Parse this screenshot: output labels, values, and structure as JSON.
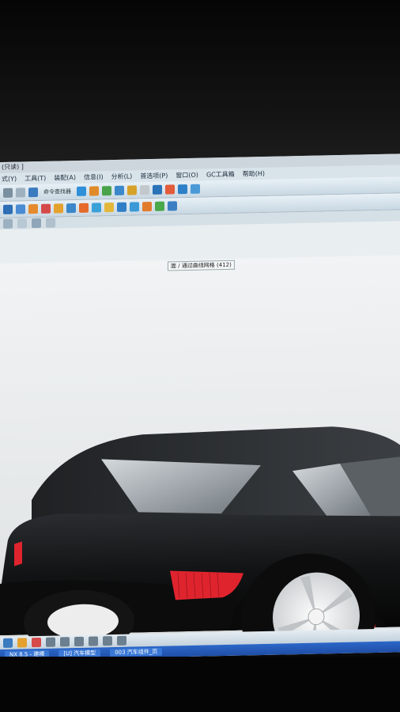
{
  "window": {
    "title": "(只读) ]"
  },
  "menu": [
    "式(Y)",
    "工具(T)",
    "装配(A)",
    "信息(I)",
    "分析(L)",
    "首选项(P)",
    "窗口(O)",
    "GC工具箱",
    "帮助(H)"
  ],
  "toolbar": {
    "command_finder_label": "命令查找器"
  },
  "selection_filter": {
    "scope": "面",
    "rule": "通过曲线网格 (412)"
  },
  "cursor_tooltip": {
    "scope": "面",
    "rule": "通过"
  },
  "taskbar": {
    "items": [
      "NX 8.5 - 建模",
      "[U] 汽车模型",
      "003 汽车组件_页"
    ]
  },
  "colors": {
    "car_body": "#141414",
    "taillight": "#e0242e",
    "wheel_rim": "#e7e7e7",
    "accent": "#2f6bd0"
  }
}
